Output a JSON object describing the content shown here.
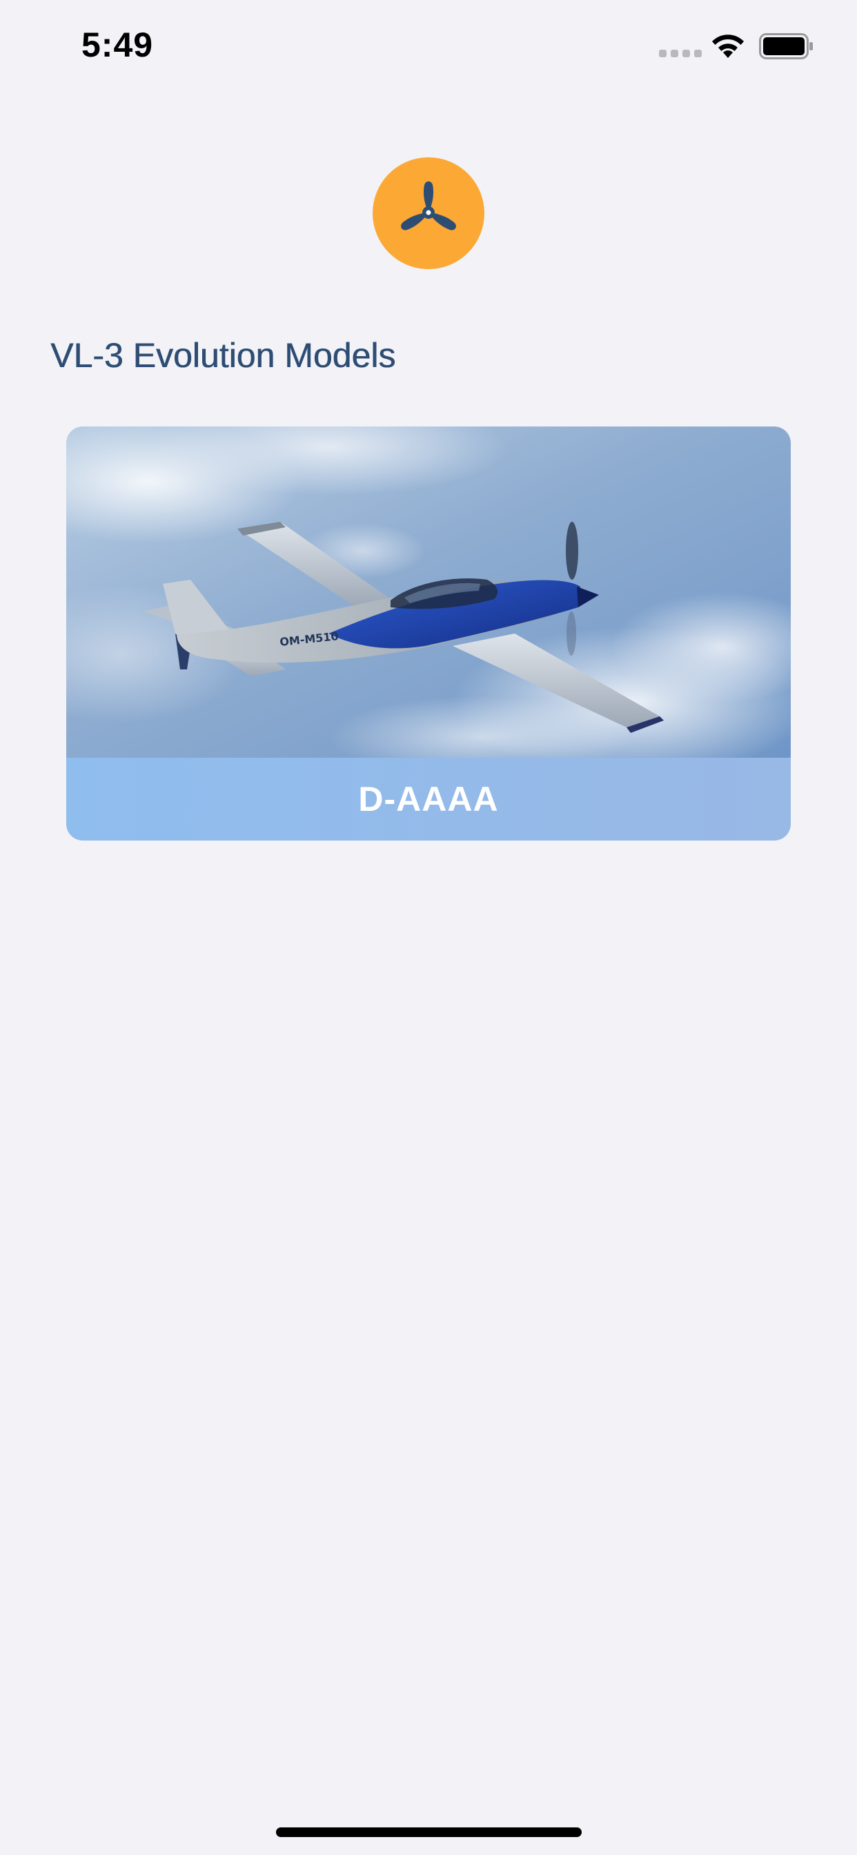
{
  "status_bar": {
    "time": "5:49",
    "icons": [
      "cellular-signal-icon",
      "wifi-icon",
      "battery-icon"
    ]
  },
  "app": {
    "logo_icon": "propeller-icon",
    "logo_color": "#fca834",
    "icon_color": "#2e4d73"
  },
  "section": {
    "title": "VL-3 Evolution Models"
  },
  "aircraft_list": [
    {
      "registration": "D-AAAA",
      "fuselage_text": "OM-M510",
      "image": "aircraft-photo"
    }
  ],
  "colors": {
    "background": "#f2f2f7",
    "title": "#2e4d73",
    "caption_bar": "#93bbec"
  }
}
